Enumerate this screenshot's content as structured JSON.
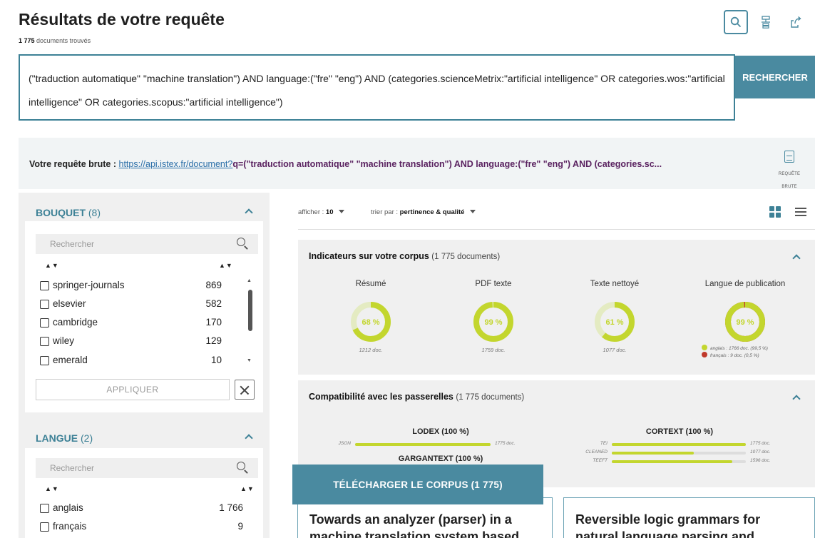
{
  "header": {
    "title": "Résultats de votre requête",
    "count_value": "1 775",
    "count_label": "documents trouvés"
  },
  "toolbar": {
    "search_icon": "search-icon",
    "tree_icon": "tree-structure-icon",
    "share_icon": "share-export-icon"
  },
  "query": {
    "text": "(\"traduction automatique\" \"machine translation\") AND language:(\"fre\" \"eng\") AND (categories.scienceMetrix:\"artificial intelligence\" OR categories.wos:\"artificial intelligence\" OR categories.scopus:\"artificial intelligence\")",
    "search_label": "RECHERCHER"
  },
  "raw_request": {
    "label": "Votre requête brute :",
    "url": "https://api.istex.fr/document?",
    "query": "q=(\"traduction automatique\" \"machine translation\") AND language:(\"fre\" \"eng\") AND (categories.sc...",
    "icon_label": "REQUÊTE BRUTE"
  },
  "facets": {
    "bouquet": {
      "title": "BOUQUET",
      "count": "(8)",
      "search_placeholder": "Rechercher",
      "sort_label": "▲▼",
      "items": [
        {
          "label": "springer-journals",
          "count": "869"
        },
        {
          "label": "elsevier",
          "count": "582"
        },
        {
          "label": "cambridge",
          "count": "170"
        },
        {
          "label": "wiley",
          "count": "129"
        },
        {
          "label": "emerald",
          "count": "10"
        }
      ],
      "apply_label": "APPLIQUER"
    },
    "langue": {
      "title": "LANGUE",
      "count": "(2)",
      "search_placeholder": "Rechercher",
      "sort_label": "▲▼",
      "items": [
        {
          "label": "anglais",
          "count": "1 766"
        },
        {
          "label": "français",
          "count": "9"
        }
      ]
    }
  },
  "results_toolbar": {
    "show_label": "afficher :",
    "show_value": "10",
    "sort_label": "trier par :",
    "sort_value": "pertinence & qualité"
  },
  "indicators": {
    "title": "Indicateurs sur votre corpus",
    "subtitle": "(1 775 documents)",
    "gauges": [
      {
        "label": "Résumé",
        "percent": 68,
        "text": "68 %",
        "docs": "1212 doc."
      },
      {
        "label": "PDF texte",
        "percent": 99,
        "text": "99 %",
        "docs": "1759 doc."
      },
      {
        "label": "Texte nettoyé",
        "percent": 61,
        "text": "61 %",
        "docs": "1077 doc."
      },
      {
        "label": "Langue de publication",
        "percent": 99,
        "text": "99 %",
        "docs": ""
      }
    ],
    "legend": [
      {
        "text": "anglais : 1766 doc. (99,5 %)",
        "color": "#c3d62e"
      },
      {
        "text": "français : 9 doc. (0,5 %)",
        "color": "#c0392b"
      }
    ]
  },
  "compat": {
    "title": "Compatibilité avec les passerelles",
    "subtitle": "(1 775 documents)",
    "lodex": {
      "title": "LODEX (100 %)",
      "rows": [
        {
          "key": "JSON",
          "percent": 100,
          "value": "1775 doc."
        }
      ]
    },
    "gargantext": {
      "title": "GARGANTEXT (100 %)"
    },
    "cortext": {
      "title": "CORTEXT (100 %)",
      "rows": [
        {
          "key": "TEI",
          "percent": 100,
          "value": "1775 doc."
        },
        {
          "key": "CLEANED",
          "percent": 61,
          "value": "1077 doc."
        },
        {
          "key": "TEEFT",
          "percent": 90,
          "value": "1596 doc."
        }
      ]
    }
  },
  "download": {
    "label": "TÉLÉCHARGER LE CORPUS (1 775)"
  },
  "cards": [
    {
      "title": "Towards an analyzer (parser) in a machine translation system based"
    },
    {
      "title": "Reversible logic grammars for natural language parsing and"
    }
  ],
  "colors": {
    "accent": "#4a8aa0",
    "gauge_fill": "#c3d62e",
    "gauge_track": "#e4ebc2"
  }
}
